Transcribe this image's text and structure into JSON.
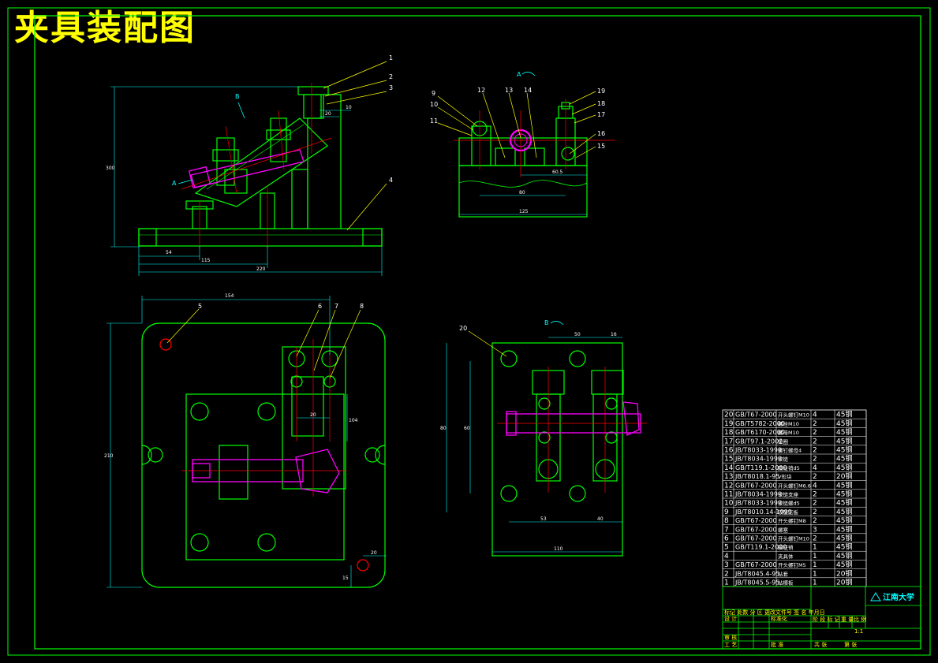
{
  "title": "夹具装配图",
  "view_labels": {
    "A_arrow": "A",
    "B_arrow": "B",
    "A_section": "A",
    "B_section": "B"
  },
  "front_view": {
    "balloons": [
      "1",
      "2",
      "3",
      "4"
    ],
    "dims": [
      "54",
      "115",
      "220",
      "10",
      "20",
      "300"
    ]
  },
  "side_view_top": {
    "balloons": [
      "9",
      "10",
      "11",
      "12",
      "13",
      "14",
      "19",
      "18",
      "17",
      "16",
      "15"
    ],
    "dims": [
      "60.5",
      "80",
      "125"
    ]
  },
  "plan_view": {
    "balloons": [
      "5",
      "6",
      "7",
      "8"
    ],
    "dims": [
      "154",
      "210",
      "20",
      "15",
      "20",
      "104"
    ]
  },
  "side_view_bottom": {
    "balloons": [
      "20"
    ],
    "dims": [
      "50",
      "16",
      "80",
      "60",
      "53",
      "40",
      "110"
    ]
  },
  "bom": [
    {
      "no": "20",
      "std": "GB/T67-2000",
      "name": "开头螺钉M10",
      "qty": "4",
      "mat": "45钢"
    },
    {
      "no": "19",
      "std": "GB/T5782-2000",
      "name": "螺栓M10",
      "qty": "2",
      "mat": "45钢"
    },
    {
      "no": "18",
      "std": "GB/T6170-2000",
      "name": "螺母M10",
      "qty": "2",
      "mat": "45钢"
    },
    {
      "no": "17",
      "std": "GB/T97.1-2002",
      "name": "垫圈",
      "qty": "2",
      "mat": "45钢"
    },
    {
      "no": "16",
      "std": "JB/T8033-1999",
      "name": "螺钉螺母4",
      "qty": "2",
      "mat": "45钢"
    },
    {
      "no": "15",
      "std": "JB/T8034-1999",
      "name": "铰链",
      "qty": "2",
      "mat": "45钢"
    },
    {
      "no": "14",
      "std": "GB/T119.1-2000",
      "name": "圆柱销d5",
      "qty": "4",
      "mat": "45钢"
    },
    {
      "no": "13",
      "std": "JB/T8018.1-95",
      "name": "V形块",
      "qty": "2",
      "mat": "20钢"
    },
    {
      "no": "12",
      "std": "GB/T67-2000",
      "name": "开头螺钉M6.6",
      "qty": "4",
      "mat": "45钢"
    },
    {
      "no": "11",
      "std": "JB/T8034-1999",
      "name": "铰链支座",
      "qty": "2",
      "mat": "45钢"
    },
    {
      "no": "10",
      "std": "JB/T8033-1999",
      "name": "铰链螺d5",
      "qty": "2",
      "mat": "45钢"
    },
    {
      "no": "9",
      "std": "JB/T8010.14-1999",
      "name": "铰链压板",
      "qty": "2",
      "mat": "45钢"
    },
    {
      "no": "8",
      "std": "GB/T67-2000",
      "name": "开头螺钉M8",
      "qty": "2",
      "mat": "45钢"
    },
    {
      "no": "7",
      "std": "GB/T67-2000",
      "name": "螺塞",
      "qty": "3",
      "mat": "45钢"
    },
    {
      "no": "6",
      "std": "GB/T67-2000",
      "name": "开头螺钉M10",
      "qty": "2",
      "mat": "45钢"
    },
    {
      "no": "5",
      "std": "GB/T119.1-2000",
      "name": "圆柱销",
      "qty": "1",
      "mat": "45钢"
    },
    {
      "no": "4",
      "std": "",
      "name": "夹具体",
      "qty": "1",
      "mat": "45钢"
    },
    {
      "no": "3",
      "std": "GB/T67-2000",
      "name": "开头螺钉M5",
      "qty": "1",
      "mat": "45钢"
    },
    {
      "no": "2",
      "std": "JB/T8045.4-95",
      "name": "钻套",
      "qty": "1",
      "mat": "20钢"
    },
    {
      "no": "1",
      "std": "JB/T8045.5-95",
      "name": "钻模板",
      "qty": "1",
      "mat": "20钢"
    }
  ],
  "title_block": {
    "school": "江南大学",
    "scale": "1:1",
    "sheet_label": "共 张",
    "sheet_label2": "第 张",
    "row1": "标记 处数 分 区 更改文件号 签 名 年月日",
    "row2": "设 计",
    "row2b": "标准化",
    "row3": "审 核",
    "row4": "工 艺",
    "row4b": "批 准",
    "stage": "阶 段 标 记",
    "weight": "重 量",
    "ratio": "比 例"
  },
  "colors": {
    "border": "#00ff00",
    "outline": "#00ff00",
    "centerline": "#ff0000",
    "dimension": "#00ffff",
    "leader": "#ffff00",
    "highlight": "#ff00ff",
    "title": "#ffff00"
  }
}
